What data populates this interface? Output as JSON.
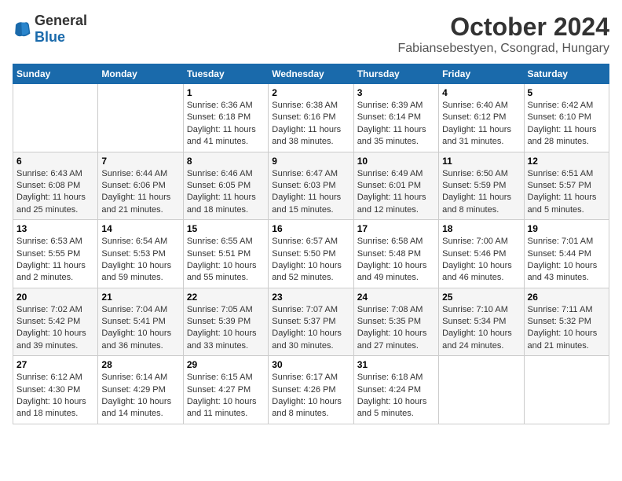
{
  "header": {
    "logo_general": "General",
    "logo_blue": "Blue",
    "month": "October 2024",
    "location": "Fabiansebestyen, Csongrad, Hungary"
  },
  "weekdays": [
    "Sunday",
    "Monday",
    "Tuesday",
    "Wednesday",
    "Thursday",
    "Friday",
    "Saturday"
  ],
  "weeks": [
    [
      {
        "day": "",
        "info": ""
      },
      {
        "day": "",
        "info": ""
      },
      {
        "day": "1",
        "sunrise": "6:36 AM",
        "sunset": "6:18 PM",
        "daylight": "11 hours and 41 minutes."
      },
      {
        "day": "2",
        "sunrise": "6:38 AM",
        "sunset": "6:16 PM",
        "daylight": "11 hours and 38 minutes."
      },
      {
        "day": "3",
        "sunrise": "6:39 AM",
        "sunset": "6:14 PM",
        "daylight": "11 hours and 35 minutes."
      },
      {
        "day": "4",
        "sunrise": "6:40 AM",
        "sunset": "6:12 PM",
        "daylight": "11 hours and 31 minutes."
      },
      {
        "day": "5",
        "sunrise": "6:42 AM",
        "sunset": "6:10 PM",
        "daylight": "11 hours and 28 minutes."
      }
    ],
    [
      {
        "day": "6",
        "sunrise": "6:43 AM",
        "sunset": "6:08 PM",
        "daylight": "11 hours and 25 minutes."
      },
      {
        "day": "7",
        "sunrise": "6:44 AM",
        "sunset": "6:06 PM",
        "daylight": "11 hours and 21 minutes."
      },
      {
        "day": "8",
        "sunrise": "6:46 AM",
        "sunset": "6:05 PM",
        "daylight": "11 hours and 18 minutes."
      },
      {
        "day": "9",
        "sunrise": "6:47 AM",
        "sunset": "6:03 PM",
        "daylight": "11 hours and 15 minutes."
      },
      {
        "day": "10",
        "sunrise": "6:49 AM",
        "sunset": "6:01 PM",
        "daylight": "11 hours and 12 minutes."
      },
      {
        "day": "11",
        "sunrise": "6:50 AM",
        "sunset": "5:59 PM",
        "daylight": "11 hours and 8 minutes."
      },
      {
        "day": "12",
        "sunrise": "6:51 AM",
        "sunset": "5:57 PM",
        "daylight": "11 hours and 5 minutes."
      }
    ],
    [
      {
        "day": "13",
        "sunrise": "6:53 AM",
        "sunset": "5:55 PM",
        "daylight": "11 hours and 2 minutes."
      },
      {
        "day": "14",
        "sunrise": "6:54 AM",
        "sunset": "5:53 PM",
        "daylight": "10 hours and 59 minutes."
      },
      {
        "day": "15",
        "sunrise": "6:55 AM",
        "sunset": "5:51 PM",
        "daylight": "10 hours and 55 minutes."
      },
      {
        "day": "16",
        "sunrise": "6:57 AM",
        "sunset": "5:50 PM",
        "daylight": "10 hours and 52 minutes."
      },
      {
        "day": "17",
        "sunrise": "6:58 AM",
        "sunset": "5:48 PM",
        "daylight": "10 hours and 49 minutes."
      },
      {
        "day": "18",
        "sunrise": "7:00 AM",
        "sunset": "5:46 PM",
        "daylight": "10 hours and 46 minutes."
      },
      {
        "day": "19",
        "sunrise": "7:01 AM",
        "sunset": "5:44 PM",
        "daylight": "10 hours and 43 minutes."
      }
    ],
    [
      {
        "day": "20",
        "sunrise": "7:02 AM",
        "sunset": "5:42 PM",
        "daylight": "10 hours and 39 minutes."
      },
      {
        "day": "21",
        "sunrise": "7:04 AM",
        "sunset": "5:41 PM",
        "daylight": "10 hours and 36 minutes."
      },
      {
        "day": "22",
        "sunrise": "7:05 AM",
        "sunset": "5:39 PM",
        "daylight": "10 hours and 33 minutes."
      },
      {
        "day": "23",
        "sunrise": "7:07 AM",
        "sunset": "5:37 PM",
        "daylight": "10 hours and 30 minutes."
      },
      {
        "day": "24",
        "sunrise": "7:08 AM",
        "sunset": "5:35 PM",
        "daylight": "10 hours and 27 minutes."
      },
      {
        "day": "25",
        "sunrise": "7:10 AM",
        "sunset": "5:34 PM",
        "daylight": "10 hours and 24 minutes."
      },
      {
        "day": "26",
        "sunrise": "7:11 AM",
        "sunset": "5:32 PM",
        "daylight": "10 hours and 21 minutes."
      }
    ],
    [
      {
        "day": "27",
        "sunrise": "6:12 AM",
        "sunset": "4:30 PM",
        "daylight": "10 hours and 18 minutes."
      },
      {
        "day": "28",
        "sunrise": "6:14 AM",
        "sunset": "4:29 PM",
        "daylight": "10 hours and 14 minutes."
      },
      {
        "day": "29",
        "sunrise": "6:15 AM",
        "sunset": "4:27 PM",
        "daylight": "10 hours and 11 minutes."
      },
      {
        "day": "30",
        "sunrise": "6:17 AM",
        "sunset": "4:26 PM",
        "daylight": "10 hours and 8 minutes."
      },
      {
        "day": "31",
        "sunrise": "6:18 AM",
        "sunset": "4:24 PM",
        "daylight": "10 hours and 5 minutes."
      },
      {
        "day": "",
        "info": ""
      },
      {
        "day": "",
        "info": ""
      }
    ]
  ],
  "labels": {
    "sunrise": "Sunrise:",
    "sunset": "Sunset:",
    "daylight": "Daylight:"
  }
}
